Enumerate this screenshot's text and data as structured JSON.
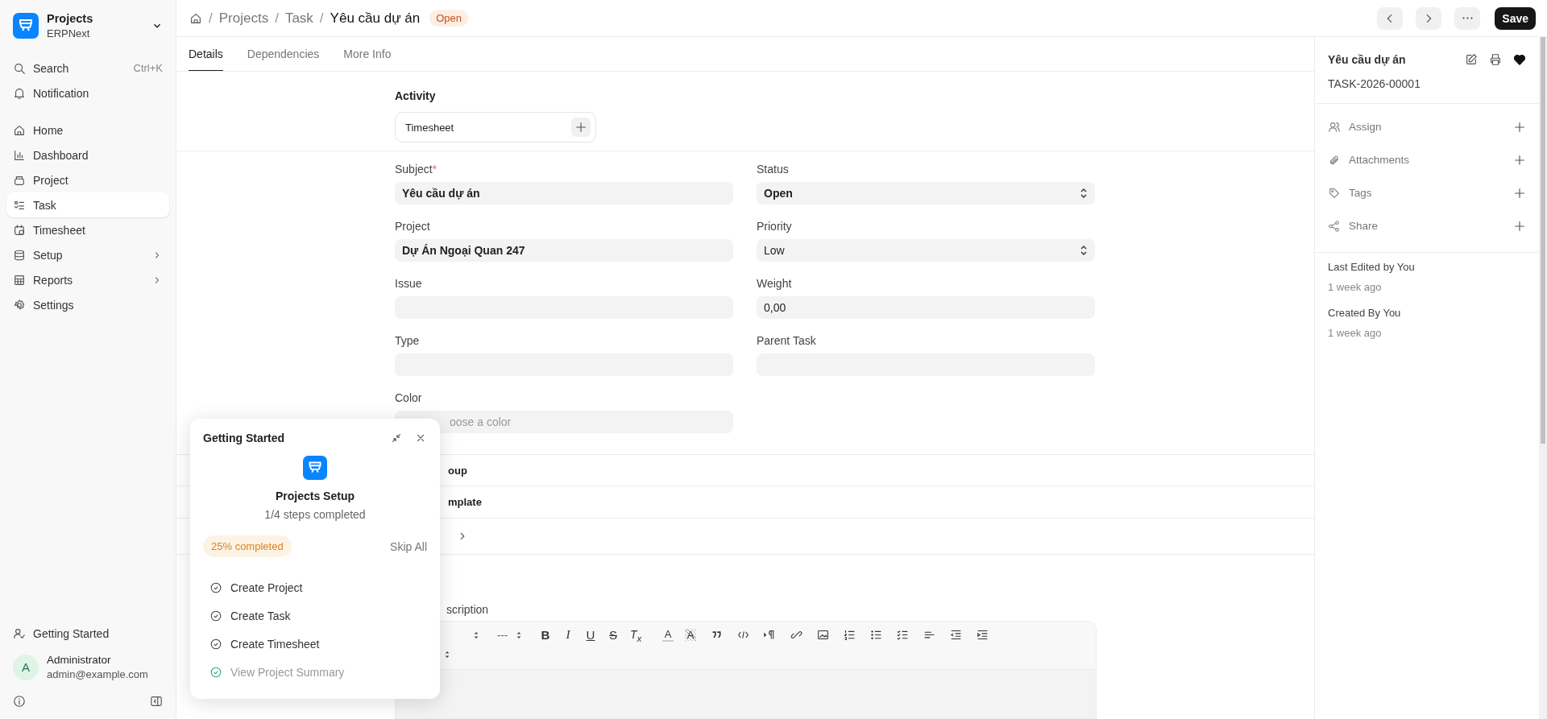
{
  "sidebar": {
    "app": {
      "title": "Projects",
      "subtitle": "ERPNext"
    },
    "search": {
      "label": "Search",
      "shortcut": "Ctrl+K"
    },
    "notification": "Notification",
    "items": [
      {
        "label": "Home",
        "selected": false,
        "expandable": false
      },
      {
        "label": "Dashboard",
        "selected": false,
        "expandable": false
      },
      {
        "label": "Project",
        "selected": false,
        "expandable": false
      },
      {
        "label": "Task",
        "selected": true,
        "expandable": false
      },
      {
        "label": "Timesheet",
        "selected": false,
        "expandable": false
      },
      {
        "label": "Setup",
        "selected": false,
        "expandable": true
      },
      {
        "label": "Reports",
        "selected": false,
        "expandable": true
      },
      {
        "label": "Settings",
        "selected": false,
        "expandable": false
      }
    ],
    "getting_started": "Getting Started",
    "user": {
      "initial": "A",
      "name": "Administrator",
      "email": "admin@example.com"
    }
  },
  "breadcrumb_separator": "/",
  "breadcrumbs": [
    "Projects",
    "Task"
  ],
  "title": "Yêu cầu dự án",
  "status_badge": "Open",
  "save": "Save",
  "tabs": [
    {
      "label": "Details",
      "selected": true
    },
    {
      "label": "Dependencies",
      "selected": false
    },
    {
      "label": "More Info",
      "selected": false
    }
  ],
  "activity": {
    "heading": "Activity",
    "items": [
      "Timesheet"
    ]
  },
  "required_mark": "*",
  "columns": [
    [
      {
        "label": "Subject",
        "required": true,
        "kind": "text",
        "value": "Yêu cầu dự án",
        "bold": true
      },
      {
        "label": "Project",
        "required": false,
        "kind": "text",
        "value": "Dự Án Ngoại Quan 247",
        "bold": true
      },
      {
        "label": "Issue",
        "required": false,
        "kind": "text"
      },
      {
        "label": "Type",
        "required": false,
        "kind": "text"
      },
      {
        "label": "Color",
        "required": false,
        "kind": "text",
        "placeholder": "oose a color"
      }
    ],
    [
      {
        "label": "Status",
        "required": false,
        "kind": "select",
        "value": "Open",
        "bold": true
      },
      {
        "label": "Priority",
        "required": false,
        "kind": "select",
        "value": "Low",
        "bold": false
      },
      {
        "label": "Weight",
        "required": false,
        "kind": "text",
        "value": "0,00",
        "bold": false
      },
      {
        "label": "Parent Task",
        "required": false,
        "kind": "text"
      }
    ]
  ],
  "sections": [
    "oup",
    "mplate"
  ],
  "description": {
    "label": "scription",
    "toolbar": [
      {
        "kind": "select"
      },
      {
        "kind": "select",
        "text": "---"
      },
      {
        "kind": "bold",
        "glyph": "B"
      },
      {
        "kind": "italic",
        "glyph": "I"
      },
      {
        "kind": "underline",
        "glyph": "U"
      },
      {
        "kind": "strike",
        "glyph": "S"
      },
      {
        "kind": "clear",
        "glyph": "T$_{x}$"
      },
      {
        "kind": "color",
        "glyph": "A"
      },
      {
        "kind": "highlight",
        "glyph": "A"
      },
      {
        "kind": "quote"
      },
      {
        "kind": "code"
      },
      {
        "kind": "para"
      },
      {
        "kind": "link"
      },
      {
        "kind": "image"
      },
      {
        "kind": "ol"
      },
      {
        "kind": "ul"
      },
      {
        "kind": "check"
      },
      {
        "kind": "align"
      },
      {
        "kind": "outdent"
      },
      {
        "kind": "indent"
      }
    ]
  },
  "sidebar_panel": {
    "title": "Yêu cầu dự án",
    "id": "TASK-2026-00001",
    "actions": [
      "Assign",
      "Attachments",
      "Tags",
      "Share"
    ],
    "log": [
      {
        "text": "Last Edited by You",
        "time": "1 week ago"
      },
      {
        "text": "Created By You",
        "time": "1 week ago"
      }
    ]
  },
  "popup": {
    "title": "Getting Started",
    "heading": "Projects Setup",
    "steps_count": "1/4 steps completed",
    "badge": "25% completed",
    "skip": "Skip All",
    "steps": [
      {
        "label": "Create Project",
        "done": false
      },
      {
        "label": "Create Task",
        "done": false
      },
      {
        "label": "Create Timesheet",
        "done": false
      },
      {
        "label": "View Project Summary",
        "done": true
      }
    ]
  }
}
